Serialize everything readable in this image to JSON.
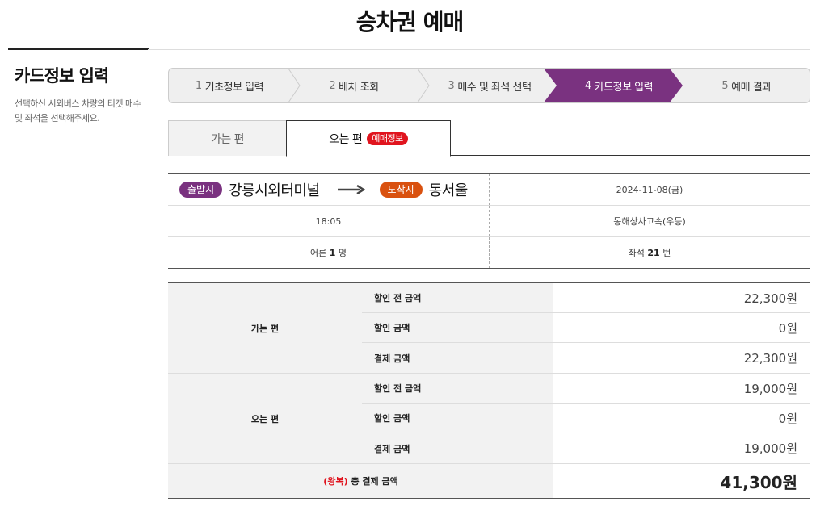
{
  "page_title": "승차권 예매",
  "side": {
    "heading": "카드정보 입력",
    "description": "선택하신 시외버스 차량의 티켓 매수 및 좌석을 선택해주세요."
  },
  "steps": [
    {
      "num": "1",
      "label": "기초정보 입력"
    },
    {
      "num": "2",
      "label": "배차 조회"
    },
    {
      "num": "3",
      "label": "매수 및 좌석 선택"
    },
    {
      "num": "4",
      "label": "카드정보 입력",
      "active": true
    },
    {
      "num": "5",
      "label": "예매 결과"
    }
  ],
  "tabs": {
    "outbound": "가는 편",
    "return": "오는 편",
    "return_badge": "예매정보"
  },
  "trip": {
    "dep_badge": "출발지",
    "departure": "강릉시외터미널",
    "arr_badge": "도착지",
    "arrival": "동서울",
    "date": "2024-11-08(금)",
    "time": "18:05",
    "company": "동해상사고속(우등)",
    "passenger_prefix": "어른",
    "passenger_count": "1",
    "passenger_unit": "명",
    "seat_prefix": "좌석",
    "seat_number": "21",
    "seat_unit": "번"
  },
  "fares": [
    {
      "group": "가는 편",
      "rows": [
        {
          "label": "할인 전 금액",
          "value": "22,300원"
        },
        {
          "label": "할인 금액",
          "value": "0원"
        },
        {
          "label": "결제 금액",
          "value": "22,300원"
        }
      ]
    },
    {
      "group": "오는 편",
      "rows": [
        {
          "label": "할인 전 금액",
          "value": "19,000원"
        },
        {
          "label": "할인 금액",
          "value": "0원"
        },
        {
          "label": "결제 금액",
          "value": "19,000원"
        }
      ]
    }
  ],
  "total": {
    "prefix": "(왕복)",
    "label": "총 결제 금액",
    "value": "41,300원"
  },
  "colors": {
    "accent_purple": "#7a3280",
    "accent_orange": "#d9510f",
    "accent_red": "#e0141e"
  }
}
